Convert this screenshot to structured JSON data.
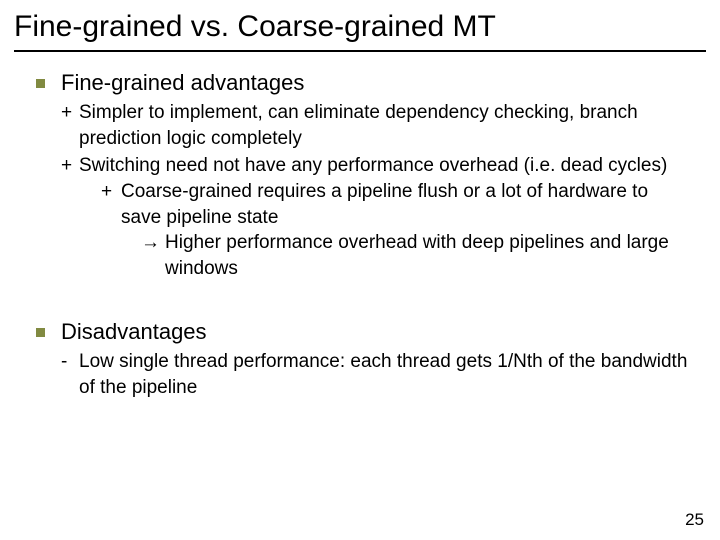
{
  "title": "Fine-grained vs. Coarse-grained MT",
  "section1": {
    "label": "Fine-grained advantages",
    "p1_sign": "+",
    "p1_text": "Simpler to implement, can eliminate dependency checking, branch prediction logic completely",
    "p2_sign": "+",
    "p2_text": "Switching need not have any performance overhead (i.e. dead cycles)",
    "p2a_sign": "+",
    "p2a_text": "Coarse-grained requires a pipeline flush or a lot of hardware to save pipeline state",
    "p2b_sign": "→",
    "p2b_text": "Higher performance overhead with deep pipelines and large windows"
  },
  "section2": {
    "label": "Disadvantages",
    "p1_sign": "-",
    "p1_text": "Low single thread performance: each thread gets 1/Nth of the bandwidth of the pipeline"
  },
  "page_number": "25"
}
